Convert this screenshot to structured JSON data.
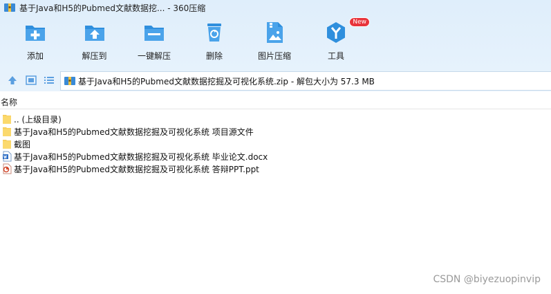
{
  "window": {
    "title": "基于Java和H5的Pubmed文献数据挖... - 360压缩"
  },
  "toolbar": {
    "items": [
      {
        "label": "添加",
        "icon": "add-icon"
      },
      {
        "label": "解压到",
        "icon": "extract-to-icon"
      },
      {
        "label": "一键解压",
        "icon": "one-click-extract-icon"
      },
      {
        "label": "删除",
        "icon": "delete-icon"
      },
      {
        "label": "图片压缩",
        "icon": "image-compress-icon"
      },
      {
        "label": "工具",
        "icon": "tools-icon",
        "badge": "New"
      }
    ]
  },
  "path": {
    "text": "基于Java和H5的Pubmed文献数据挖掘及可视化系统.zip - 解包大小为 57.3 MB"
  },
  "columns": {
    "name": "名称"
  },
  "files": [
    {
      "name": ".. (上级目录)",
      "type": "folder"
    },
    {
      "name": "基于Java和H5的Pubmed文献数据挖掘及可视化系统 项目源文件",
      "type": "folder"
    },
    {
      "name": "截图",
      "type": "folder"
    },
    {
      "name": "基于Java和H5的Pubmed文献数据挖掘及可视化系统 毕业论文.docx",
      "type": "docx"
    },
    {
      "name": "基于Java和H5的Pubmed文献数据挖掘及可视化系统 答辩PPT.ppt",
      "type": "ppt"
    }
  ],
  "watermark": "CSDN @biyezuopinvip",
  "colors": {
    "accent": "#2f8fdd",
    "folder": "#f7cf5f",
    "badge": "#e8343b"
  }
}
